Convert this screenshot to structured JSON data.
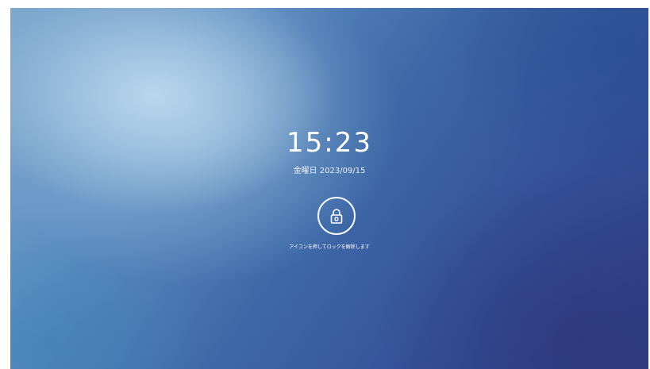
{
  "lock_screen": {
    "time": "15:23",
    "date": "金曜日 2023/09/15",
    "unlock_icon": "lock-icon",
    "hint": "アイコンを押してロックを解除します"
  },
  "colors": {
    "text": "#ffffff",
    "background_light": "#c4def0",
    "background_dark": "#2f3f86"
  }
}
